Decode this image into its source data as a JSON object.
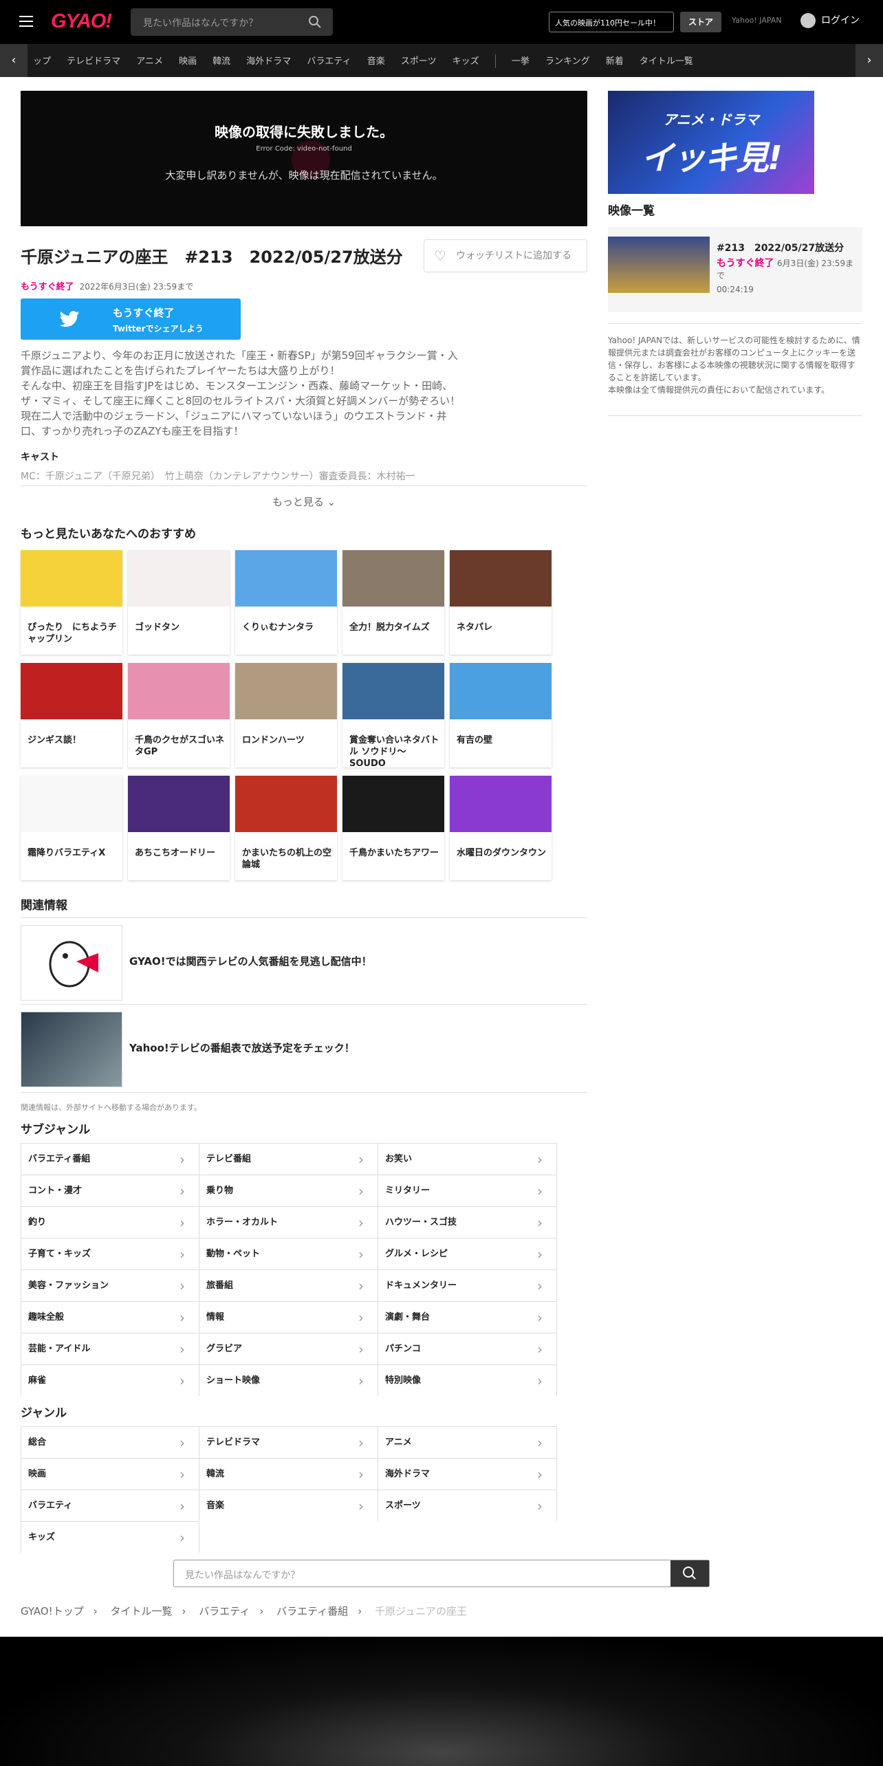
{
  "header": {
    "logo": "GYAO!",
    "search_placeholder": "見たい作品はなんですか？",
    "sale": "人気の映画が110円セール中！",
    "store": "ストア",
    "yahoo": "Yahoo! JAPAN",
    "login": "ログイン"
  },
  "nav": {
    "items": [
      "ップ",
      "テレビドラマ",
      "アニメ",
      "映画",
      "韓流",
      "海外ドラマ",
      "バラエティ",
      "音楽",
      "スポーツ",
      "キッズ",
      "一挙",
      "ランキング",
      "新着",
      "タイトル一覧"
    ]
  },
  "player": {
    "error_title": "映像の取得に失敗しました。",
    "error_code": "Error Code: video-not-found",
    "error_msg": "大変申し訳ありませんが、映像は現在配信されていません。"
  },
  "episode": {
    "title": "千原ジュニアの座王　#213　2022/05/27放送分",
    "watchlist": "ウォッチリストに追加する",
    "ending_badge": "もうすぐ終了",
    "ending_date": "2022年6月3日(金) 23:59まで"
  },
  "twitter": {
    "line1": "もうすぐ終了",
    "line2": "Twitterでシェアしよう"
  },
  "description": [
    "千原ジュニアより、今年のお正月に放送された「座王・新春SP」が第59回ギャラクシー賞・入",
    "賞作品に選ばれたことを告げられたプレイヤーたちは大盛り上がり！",
    "そんな中、初座王を目指すJPをはじめ、モンスターエンジン・西森、藤崎マーケット・田崎、",
    "ザ・マミィ、そして座王に輝くこと8回のセルライトスパ・大須賀と好調メンバーが勢ぞろい！",
    "現在二人で活動中のジェラードン、「ジュニアにハマっていないほう」のウエストランド・井",
    "口、すっかり売れっ子のZAZYも座王を目指す！"
  ],
  "cast_label": "キャスト",
  "cast_value": "MC：千原ジュニア（千原兄弟）　竹上萌奈（カンテレアナウンサー）審査委員長：木村祐一",
  "more": "もっと見る",
  "reco_heading": "もっと見たいあなたへのおすすめ",
  "reco": [
    "ぴったり　にちようチャップリン",
    "ゴッドタン",
    "くりぃむナンタラ",
    "全力！脱力タイムズ",
    "ネタパレ",
    "ジンギス談！",
    "千鳥のクセがスゴいネタGP",
    "ロンドンハーツ",
    "賞金奪い合いネタバトル ソウドリ～SOUDO",
    "有吉の壁",
    "霜降りバラエティX",
    "あちこちオードリー",
    "かまいたちの机上の空論城",
    "千鳥かまいたちアワー",
    "水曜日のダウンタウン"
  ],
  "related_heading": "関連情報",
  "related": [
    "GYAO!では関西テレビの人気番組を見逃し配信中！",
    "Yahoo!テレビの番組表で放送予定をチェック！"
  ],
  "related_note": "関連情報は、外部サイトへ移動する場合があります。",
  "subgenre_heading": "サブジャンル",
  "subgenres": [
    "バラエティ番組",
    "テレビ番組",
    "お笑い",
    "コント・漫才",
    "乗り物",
    "ミリタリー",
    "釣り",
    "ホラー・オカルト",
    "ハウツー・スゴ技",
    "子育て・キッズ",
    "動物・ペット",
    "グルメ・レシピ",
    "美容・ファッション",
    "旅番組",
    "ドキュメンタリー",
    "趣味全般",
    "情報",
    "演劇・舞台",
    "芸能・アイドル",
    "グラビア",
    "パチンコ",
    "麻雀",
    "ショート映像",
    "特別映像"
  ],
  "genre_heading": "ジャンル",
  "genres": [
    "総合",
    "テレビドラマ",
    "アニメ",
    "映画",
    "韓流",
    "海外ドラマ",
    "バラエティ",
    "音楽",
    "スポーツ",
    "キッズ"
  ],
  "bottom_search_placeholder": "見たい作品はなんですか？",
  "breadcrumb": [
    "GYAO!トップ",
    "タイトル一覧",
    "バラエティ",
    "バラエティ番組",
    "千原ジュニアの座王"
  ],
  "side": {
    "banner_small": "アニメ・ドラマ",
    "banner_big": "イッキ見!",
    "list_heading": "映像一覧",
    "ep_num": "#213　2022/05/27放送分",
    "ep_badge": "もうすぐ終了",
    "ep_date": "6月3日(金) 23:59まで",
    "ep_dur": "00:24:19",
    "notice": [
      "Yahoo! JAPANでは、新しいサービスの可能性を検討するために、情報提供元または調査会社がお客様のコンピュータ上にクッキーを送信・保存し、お客様による本映像の視聴状況に関する情報を取得することを許諾しています。",
      "本映像は全て情報提供元の責任において配信されています。"
    ]
  }
}
